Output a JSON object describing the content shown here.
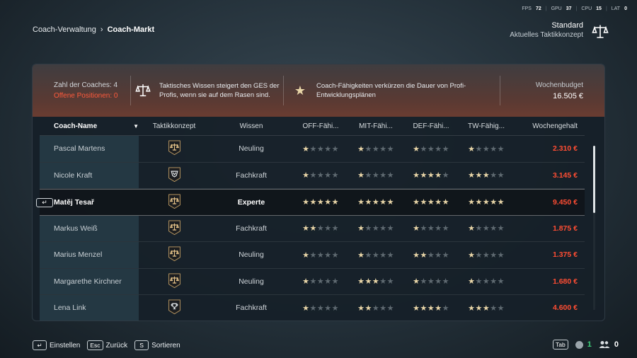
{
  "perf": {
    "fps_label": "FPS",
    "fps": "72",
    "gpu_label": "GPU",
    "gpu": "37",
    "cpu_label": "CPU",
    "cpu": "15",
    "lat_label": "LAT",
    "lat": "0"
  },
  "breadcrumb": {
    "parent": "Coach-Verwaltung",
    "current": "Coach-Markt"
  },
  "tactic": {
    "name": "Standard",
    "subtitle": "Aktuelles Taktikkonzept",
    "icon": "scales-icon"
  },
  "info": {
    "coach_count": "Zahl der Coaches: 4",
    "open_positions": "Offene Positionen: 0",
    "tip1": "Taktisches Wissen steigert den GES der Profis, wenn sie auf dem Rasen sind.",
    "tip2": "Coach-Fähigkeiten verkürzen die Dauer von Profi-Entwicklungsplänen",
    "budget_label": "Wochenbudget",
    "budget_value": "16.505 €"
  },
  "columns": {
    "name": "Coach-Name",
    "tactic": "Taktikkonzept",
    "knowledge": "Wissen",
    "off": "OFF-Fähi...",
    "mit": "MIT-Fähi...",
    "def": "DEF-Fähi...",
    "tw": "TW-Fähig...",
    "salary": "Wochengehalt"
  },
  "colors": {
    "accent_red": "#ff4d33",
    "star_on": "#e9d6a8",
    "star_off": "#5f6a71",
    "green": "#3fd17a"
  },
  "coaches": [
    {
      "name": "Pascal Martens",
      "tactic_icon": "scales-icon",
      "knowledge": "Neuling",
      "off": 1,
      "mit": 1,
      "def": 1,
      "tw": 1,
      "salary": "2.310 €"
    },
    {
      "name": "Nicole Kraft",
      "tactic_icon": "shield-crest-icon",
      "knowledge": "Fachkraft",
      "off": 1,
      "mit": 1,
      "def": 4,
      "tw": 3,
      "salary": "3.145 €"
    },
    {
      "name": "Matěj Tesař",
      "tactic_icon": "scales-icon",
      "knowledge": "Experte",
      "off": 5,
      "mit": 5,
      "def": 5,
      "tw": 5,
      "salary": "9.450 €",
      "selected": true
    },
    {
      "name": "Markus Weiß",
      "tactic_icon": "scales-icon",
      "knowledge": "Fachkraft",
      "off": 2,
      "mit": 1,
      "def": 1,
      "tw": 1,
      "salary": "1.875 €"
    },
    {
      "name": "Marius Menzel",
      "tactic_icon": "scales-icon",
      "knowledge": "Neuling",
      "off": 1,
      "mit": 1,
      "def": 2,
      "tw": 1,
      "salary": "1.375 €"
    },
    {
      "name": "Margarethe Kirchner",
      "tactic_icon": "scales-icon",
      "knowledge": "Neuling",
      "off": 1,
      "mit": 3,
      "def": 1,
      "tw": 1,
      "salary": "1.680 €"
    },
    {
      "name": "Lena Link",
      "tactic_icon": "trophy-icon",
      "knowledge": "Fachkraft",
      "off": 1,
      "mit": 2,
      "def": 4,
      "tw": 3,
      "salary": "4.600 €"
    }
  ],
  "row_enter_key": "↵",
  "footer": {
    "einstellen_key": "↵",
    "einstellen": "Einstellen",
    "zurueck_key": "Esc",
    "zurueck": "Zurück",
    "sortieren_key": "S",
    "sortieren": "Sortieren",
    "tab_key": "Tab",
    "online_count": "1",
    "friends_count": "0"
  }
}
